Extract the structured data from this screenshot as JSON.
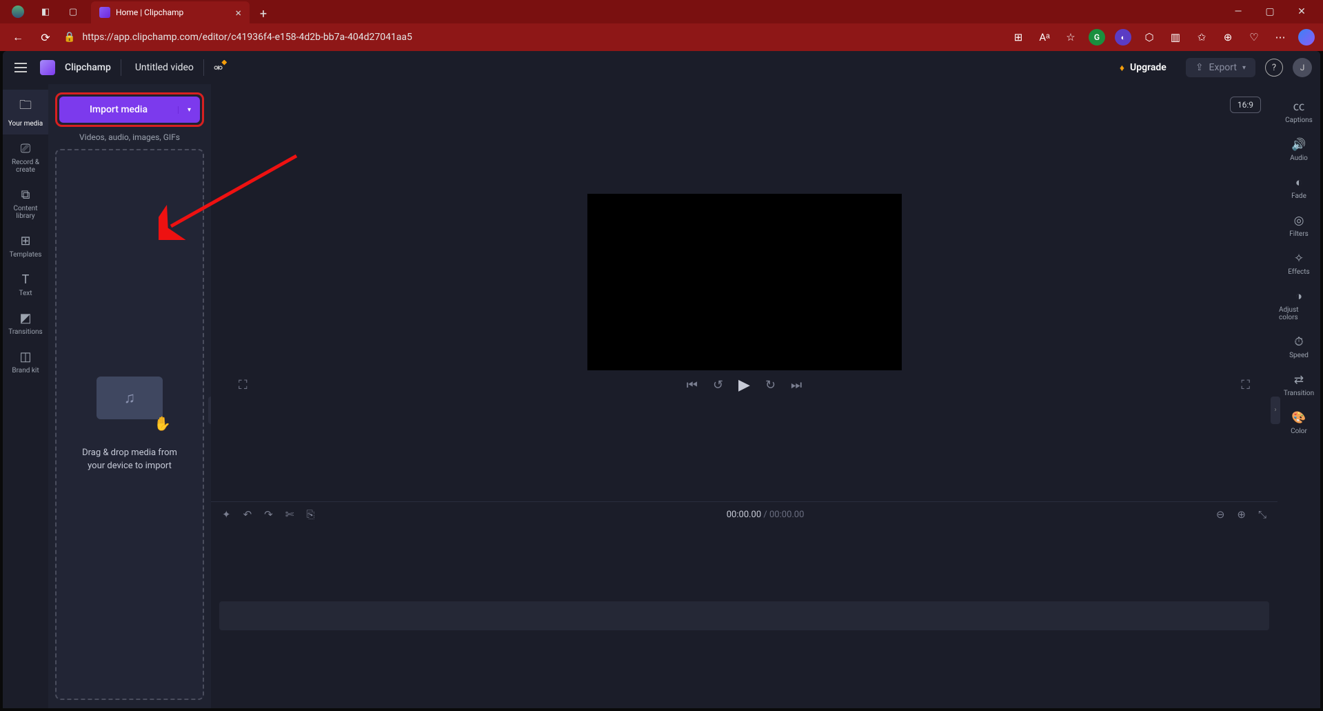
{
  "browser": {
    "tab_title": "Home | Clipchamp",
    "url": "https://app.clipchamp.com/editor/c41936f4-e158-4d2b-bb7a-404d27041aa5"
  },
  "app": {
    "name": "Clipchamp",
    "project_title": "Untitled video",
    "upgrade_label": "Upgrade",
    "export_label": "Export",
    "avatar_initial": "J",
    "aspect_ratio": "16:9"
  },
  "left_rail": [
    {
      "label": "Your media"
    },
    {
      "label": "Record & create"
    },
    {
      "label": "Content library"
    },
    {
      "label": "Templates"
    },
    {
      "label": "Text"
    },
    {
      "label": "Transitions"
    },
    {
      "label": "Brand kit"
    }
  ],
  "media_panel": {
    "import_label": "Import media",
    "import_subtext": "Videos, audio, images, GIFs",
    "drop_text_line1": "Drag & drop media from",
    "drop_text_line2": "your device to import"
  },
  "timeline": {
    "current_time": "00:00.00",
    "total_time": "00:00.00"
  },
  "right_rail": [
    {
      "label": "Captions"
    },
    {
      "label": "Audio"
    },
    {
      "label": "Fade"
    },
    {
      "label": "Filters"
    },
    {
      "label": "Effects"
    },
    {
      "label": "Adjust colors"
    },
    {
      "label": "Speed"
    },
    {
      "label": "Transition"
    },
    {
      "label": "Color"
    }
  ]
}
